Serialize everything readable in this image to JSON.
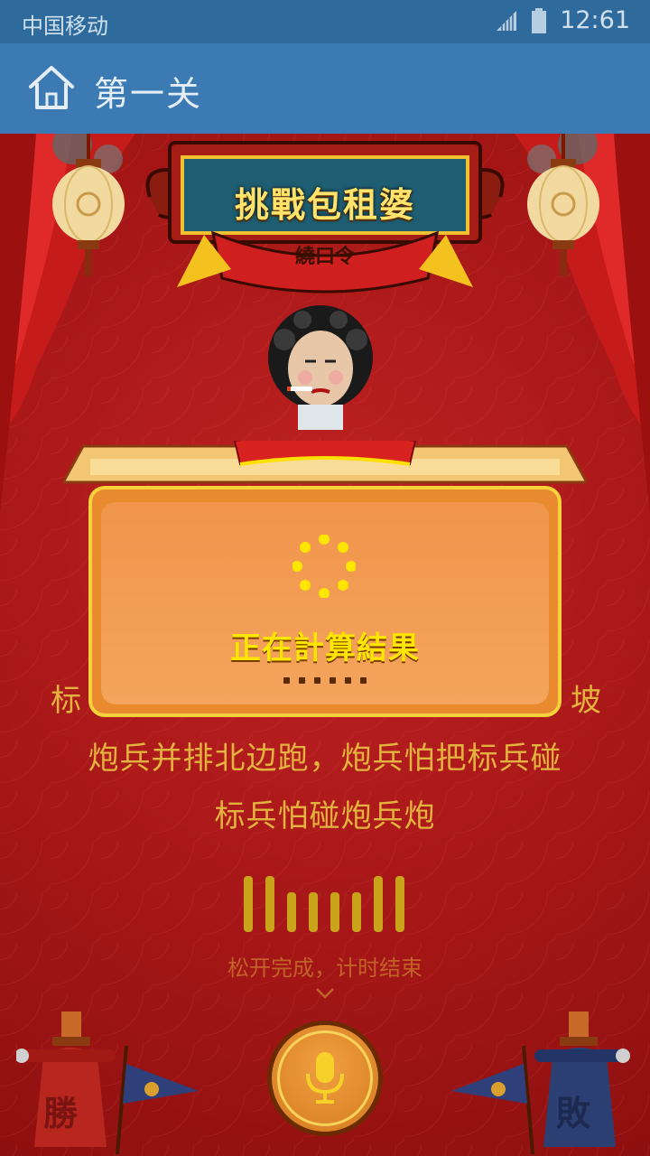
{
  "status_bar": {
    "carrier": "中国移动",
    "time": "12:61"
  },
  "app_bar": {
    "title": "第一关",
    "home_icon": "home-icon"
  },
  "sign": {
    "title": "挑戰包租婆",
    "subtitle": "繞口令"
  },
  "dialog": {
    "message": "正在計算結果"
  },
  "lyrics": {
    "line1_left": "标",
    "line1_right": "坡",
    "line2": "炮兵并排北边跑，炮兵怕把标兵碰",
    "line3": "标兵怕碰炮兵炮"
  },
  "recorder": {
    "hint": "松开完成，计时结束",
    "mic_icon": "microphone-icon"
  },
  "soldiers": {
    "win_label": "勝",
    "lose_label": "敗"
  },
  "colors": {
    "status_bar": "#2f6a9c",
    "app_bar": "#3b7ab2",
    "stage": "#a81818",
    "lyric": "#e4b23e",
    "dialog_text": "#ffe600"
  }
}
